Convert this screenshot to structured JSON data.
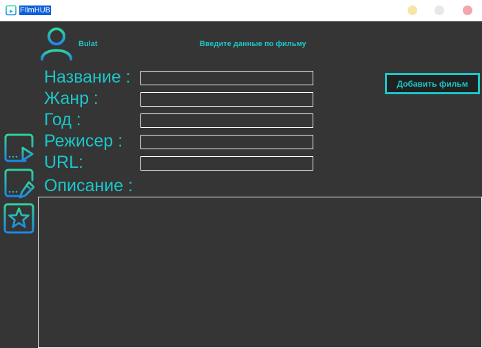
{
  "window": {
    "title": "FilmHUB"
  },
  "user": {
    "name": "Bulat"
  },
  "header": {
    "subtitle": "Введите данные по фильму"
  },
  "form": {
    "labels": {
      "title": "Название :",
      "genre": "Жанр :",
      "year": "Год :",
      "director": "Режисер :",
      "url": "URL:",
      "description": "Описание :"
    },
    "values": {
      "title": "",
      "genre": "",
      "year": "",
      "director": "",
      "url": "",
      "description": ""
    },
    "add_button": "Добавить фильм"
  },
  "sidebar": {
    "icons": [
      "play-video-icon",
      "edit-video-icon",
      "star-icon"
    ]
  },
  "colors": {
    "background": "#353535",
    "accent": "#1bc6c9",
    "icon_gradient_top": "#2fd49a",
    "icon_gradient_bottom": "#1e88e5",
    "titlebar": "#ffffff"
  }
}
